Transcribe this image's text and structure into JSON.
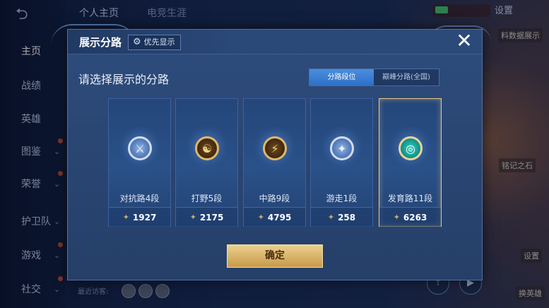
{
  "background": {
    "top_tabs": [
      "个人主页",
      "电竞生涯"
    ],
    "settings_label": "设置",
    "nav": [
      {
        "label": "主页",
        "active": true,
        "chevron": false,
        "dot": false
      },
      {
        "label": "战绩",
        "active": false,
        "chevron": false,
        "dot": false
      },
      {
        "label": "英雄",
        "active": false,
        "chevron": false,
        "dot": false
      },
      {
        "label": "图鉴",
        "active": false,
        "chevron": true,
        "dot": true
      },
      {
        "label": "荣誉",
        "active": false,
        "chevron": true,
        "dot": true
      },
      {
        "label": "护卫队",
        "active": false,
        "chevron": true,
        "dot": false
      },
      {
        "label": "游戏",
        "active": false,
        "chevron": true,
        "dot": true
      },
      {
        "label": "社交",
        "active": false,
        "chevron": true,
        "dot": true
      }
    ],
    "side_labels": [
      "料数据展示",
      "铭记之石",
      "设置",
      "换英雄"
    ],
    "recent_visitors": "最近访客:"
  },
  "modal": {
    "title": "展示分路",
    "priority_label": "优先显示",
    "prompt": "请选择展示的分路",
    "segments": [
      {
        "label": "分路段位",
        "active": true
      },
      {
        "label": "巅峰分路(全国)",
        "active": false
      }
    ],
    "cards": [
      {
        "name": "对抗路4段",
        "points": "1927",
        "badge": "silver",
        "glyph": "⚔",
        "selected": false
      },
      {
        "name": "打野5段",
        "points": "2175",
        "badge": "gold",
        "glyph": "☯",
        "selected": false
      },
      {
        "name": "中路9段",
        "points": "4795",
        "badge": "gold",
        "glyph": "⚡",
        "selected": false
      },
      {
        "name": "游走1段",
        "points": "258",
        "badge": "silver",
        "glyph": "✦",
        "selected": false
      },
      {
        "name": "发育路11段",
        "points": "6263",
        "badge": "teal",
        "glyph": "◎",
        "selected": true
      }
    ],
    "confirm_label": "确定"
  },
  "colors": {
    "accent_blue": "#2f6fc6",
    "gold_button": "#c79a4c",
    "selected_border": "#e8c98a"
  }
}
